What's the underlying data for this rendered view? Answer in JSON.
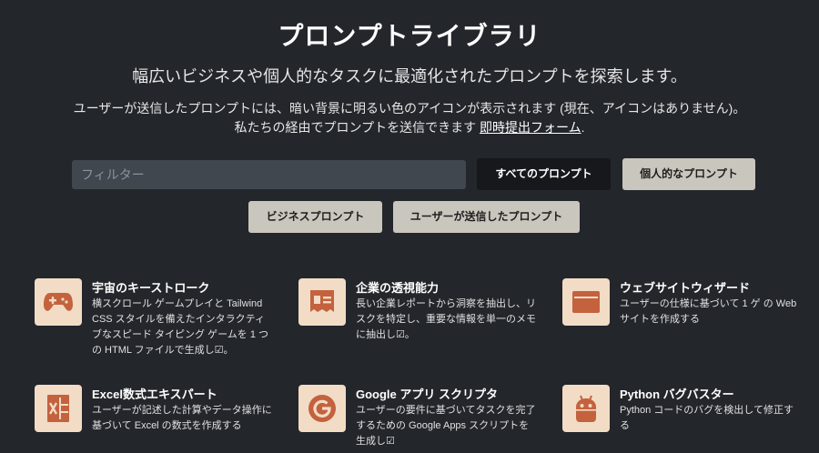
{
  "header": {
    "title": "プロンプトライブラリ",
    "subtitle": "幅広いビジネスや個人的なタスクに最適化されたプロンプトを探索します。",
    "desc_line1": "ユーザーが送信したプロンプトには、暗い背景に明るい色のアイコンが表示されます (現在、アイコンはありません)。",
    "desc_line2_prefix": "私たちの経由でプロンプトを送信できます ",
    "desc_link": "即時提出フォーム",
    "desc_line2_suffix": "."
  },
  "filter": {
    "placeholder": "フィルター"
  },
  "filters": {
    "all": "すべてのプロンプト",
    "personal": "個人的なプロンプト",
    "business": "ビジネスプロンプト",
    "user_submitted": "ユーザーが送信したプロンプト"
  },
  "cards": [
    {
      "icon": "gamepad-icon",
      "title": "宇宙のキーストローク",
      "desc": "横スクロール ゲームプレイと Tailwind CSS スタイルを備えたインタラクティブなスピード タイピング ゲームを 1 つの HTML ファイルで生成し☑。"
    },
    {
      "icon": "newspaper-icon",
      "title": "企業の透視能力",
      "desc": "長い企業レポートから洞察を抽出し、リスクを特定し、重要な情報を単一のメモに抽出し☑。"
    },
    {
      "icon": "browser-window-icon",
      "title": "ウェブサイトウィザード",
      "desc": "ユーザーの仕様に基づいて 1 ゲ の Web サイトを作成する"
    },
    {
      "icon": "spreadsheet-icon",
      "title": "Excel数式エキスパート",
      "desc": "ユーザーが記述した計算やデータ操作に基づいて Excel の数式を作成する"
    },
    {
      "icon": "google-icon",
      "title": "Google アプリ スクリプタ",
      "desc": "ユーザーの要件に基づいてタスクを完了するための Google Apps スクリプトを生成し☑"
    },
    {
      "icon": "bug-robot-icon",
      "title": "Python バグバスター",
      "desc": "Python コードのバグを検出して修正する"
    }
  ],
  "colors": {
    "background": "#23262b",
    "icon_bg": "#f2dcc6",
    "icon_fg": "#c4623e",
    "button_dark": "#16181b",
    "button_light": "#c9c6bd"
  }
}
